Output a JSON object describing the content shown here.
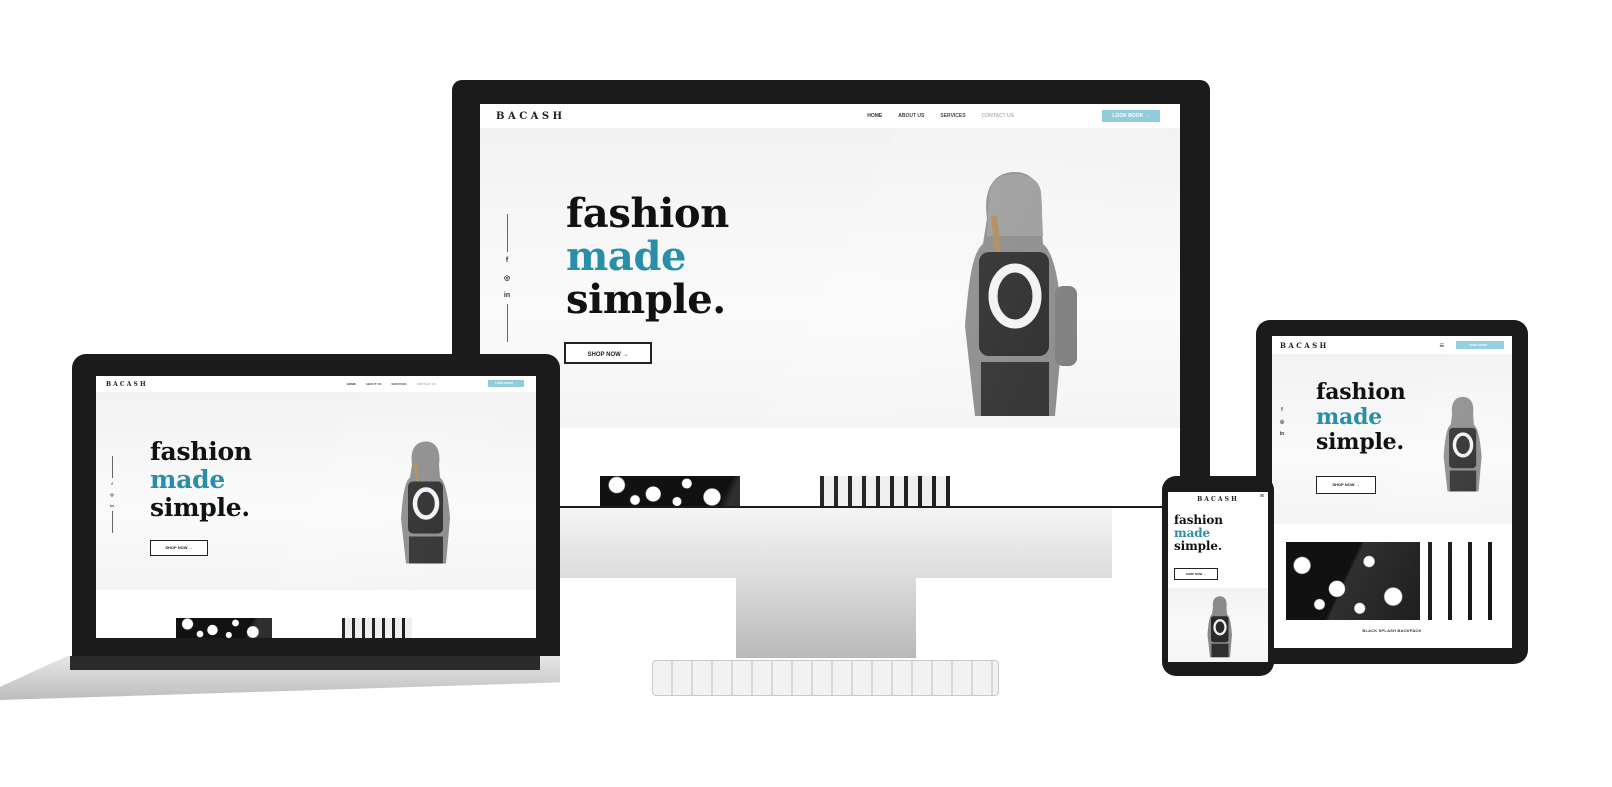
{
  "site": {
    "logo": "BACASH",
    "nav": [
      "HOME",
      "ABOUT US",
      "SERVICES",
      "CONTACT US"
    ],
    "cta": "LOOK BOOK →",
    "headline": [
      "fashion",
      "made",
      "simple."
    ],
    "shop_button": "SHOP NOW →",
    "social_icons": [
      "f",
      "◎",
      "in"
    ],
    "product_caption": "BLACK SPLASH BACKPACK"
  },
  "colors": {
    "accent_teal": "#2a8ea8",
    "cta_blue": "#8ac9d9",
    "bezel": "#1b1b1b",
    "silver": "#c9c9c9"
  },
  "icons": {
    "hamburger": "menu-icon",
    "facebook": "facebook-icon",
    "instagram": "instagram-icon",
    "linkedin": "linkedin-icon"
  }
}
